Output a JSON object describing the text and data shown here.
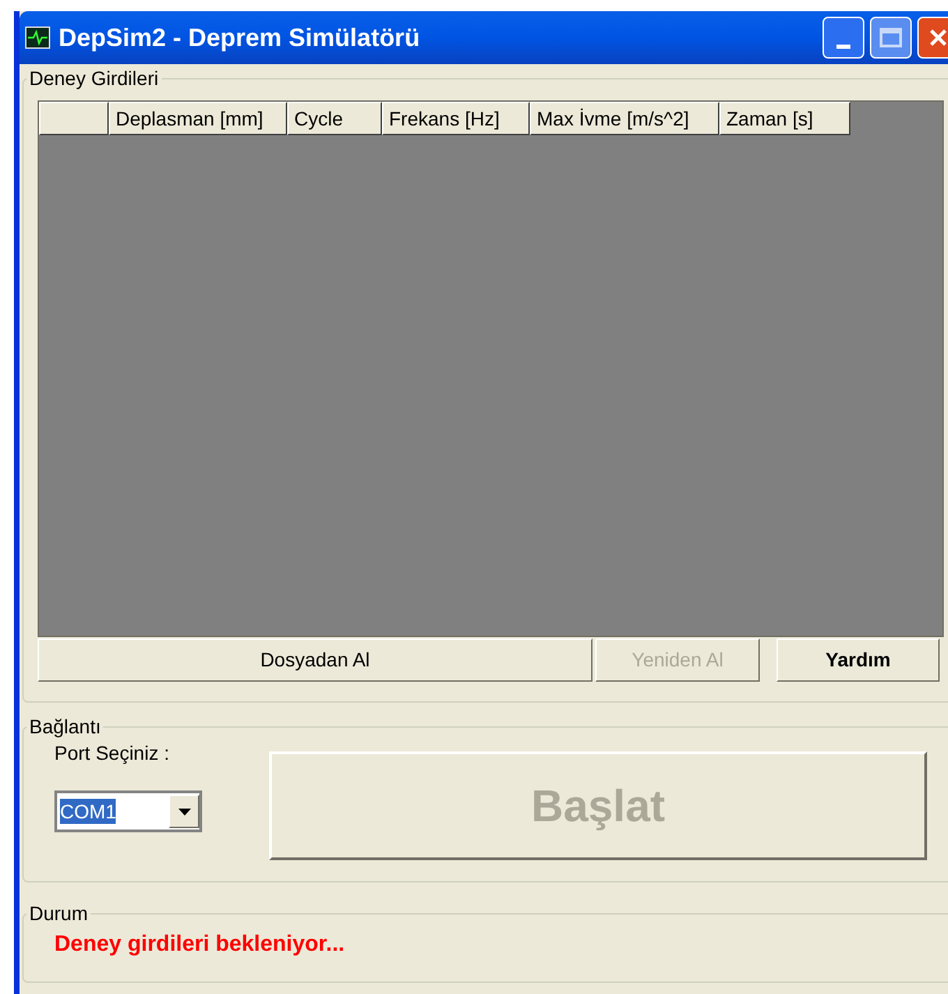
{
  "window": {
    "title": "DepSim2 - Deprem Simülatörü"
  },
  "inputs_group": {
    "title": "Deney Girdileri",
    "columns": [
      "",
      "Deplasman [mm]",
      "Cycle",
      "Frekans [Hz]",
      "Max İvme [m/s^2]",
      "Zaman [s]"
    ],
    "buttons": [
      {
        "label": "Dosyadan Al",
        "disabled": false,
        "emphasized": false
      },
      {
        "label": "Yeniden Al",
        "disabled": true,
        "emphasized": false
      },
      {
        "label": "Yardım",
        "disabled": false,
        "emphasized": true
      }
    ]
  },
  "connection_group": {
    "title": "Bağlantı",
    "port_label": "Port Seçiniz :",
    "port_value": "COM1",
    "port_value_highlighted": true,
    "start_button": {
      "label": "Başlat",
      "disabled": true
    }
  },
  "status_group": {
    "title": "Durum",
    "message": "Deney girdileri bekleniyor..."
  }
}
